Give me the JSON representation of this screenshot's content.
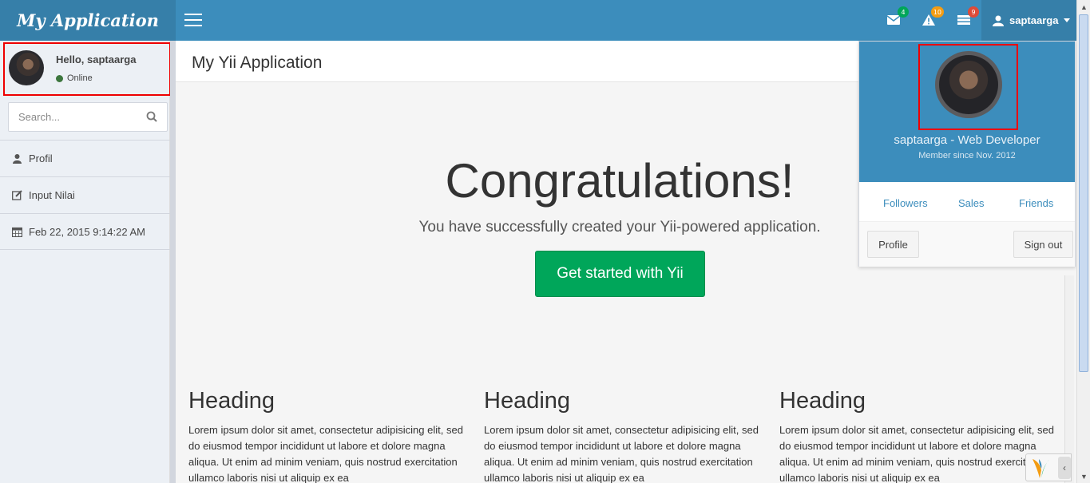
{
  "header": {
    "logo": "My Application",
    "notifications": [
      {
        "icon": "envelope-icon",
        "count": "4",
        "color": "#00a65a"
      },
      {
        "icon": "warning-icon",
        "count": "10",
        "color": "#f39c12"
      },
      {
        "icon": "tasks-icon",
        "count": "9",
        "color": "#dd4b39"
      }
    ],
    "username": "saptaarga"
  },
  "sidebar": {
    "greeting": "Hello, saptaarga",
    "status": "Online",
    "search_placeholder": "Search...",
    "items": [
      {
        "label": "Profil",
        "icon": "user-icon"
      },
      {
        "label": "Input Nilai",
        "icon": "edit-icon"
      },
      {
        "label": "Feb 22, 2015 9:14:22 AM",
        "icon": "calendar-icon"
      }
    ]
  },
  "content": {
    "page_title": "My Yii Application",
    "jumbotron": {
      "title": "Congratulations!",
      "lead": "You have successfully created your Yii-powered application.",
      "button": "Get started with Yii"
    },
    "columns": [
      {
        "heading": "Heading",
        "text": "Lorem ipsum dolor sit amet, consectetur adipisicing elit, sed do eiusmod tempor incididunt ut labore et dolore magna aliqua. Ut enim ad minim veniam, quis nostrud exercitation ullamco laboris nisi ut aliquip ex ea"
      },
      {
        "heading": "Heading",
        "text": "Lorem ipsum dolor sit amet, consectetur adipisicing elit, sed do eiusmod tempor incididunt ut labore et dolore magna aliqua. Ut enim ad minim veniam, quis nostrud exercitation ullamco laboris nisi ut aliquip ex ea"
      },
      {
        "heading": "Heading",
        "text": "Lorem ipsum dolor sit amet, consectetur adipisicing elit, sed do eiusmod tempor incididunt ut labore et dolore magna aliqua. Ut enim ad minim veniam, quis nostrud exercitation ullamco laboris nisi ut aliquip ex ea"
      }
    ]
  },
  "user_dropdown": {
    "name": "saptaarga - Web Developer",
    "member_since": "Member since Nov. 2012",
    "links": [
      "Followers",
      "Sales",
      "Friends"
    ],
    "profile_button": "Profile",
    "signout_button": "Sign out"
  },
  "colors": {
    "header": "#3c8dbc",
    "header_dark": "#367fa9",
    "success": "#00a65a",
    "highlight": "#ee0000"
  }
}
